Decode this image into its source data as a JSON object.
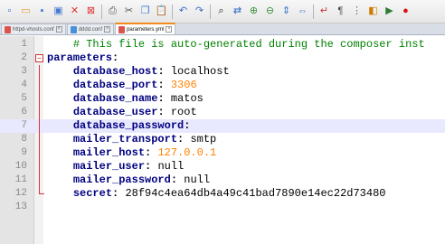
{
  "toolbar": {
    "icons": [
      "new-file-icon",
      "open-file-icon",
      "save-icon",
      "save-all-icon",
      "close-icon",
      "close-all-icon",
      "print-icon",
      "cut-icon",
      "copy-icon",
      "paste-icon",
      "undo-icon",
      "redo-icon",
      "find-icon",
      "replace-icon",
      "zoom-in-icon",
      "zoom-out-icon",
      "sync-v-icon",
      "sync-h-icon",
      "wrap-icon",
      "show-all-icon",
      "indent-guide-icon",
      "lang-icon",
      "macro-icon",
      "record-icon"
    ]
  },
  "tabs": [
    {
      "label": "httpd-vhosts.conf",
      "active": false,
      "color": "#d9534f"
    },
    {
      "label": "dddd.conf",
      "active": false,
      "color": "#4a90d9"
    },
    {
      "label": "parameters.yml",
      "active": true,
      "color": "#d9534f"
    }
  ],
  "lines": [
    {
      "num": "1",
      "indent": "    ",
      "comment": "# This file is auto-generated during the composer inst"
    },
    {
      "num": "2",
      "indent": "",
      "key": "parameters",
      "sep": ":",
      "root": true
    },
    {
      "num": "3",
      "indent": "    ",
      "key": "database_host",
      "sep": ": ",
      "value": "localhost",
      "vtype": "str"
    },
    {
      "num": "4",
      "indent": "    ",
      "key": "database_port",
      "sep": ": ",
      "value": "3306",
      "vtype": "num"
    },
    {
      "num": "5",
      "indent": "    ",
      "key": "database_name",
      "sep": ": ",
      "value": "matos",
      "vtype": "str"
    },
    {
      "num": "6",
      "indent": "    ",
      "key": "database_user",
      "sep": ": ",
      "value": "root",
      "vtype": "str"
    },
    {
      "num": "7",
      "indent": "    ",
      "key": "database_password",
      "sep": ":",
      "value": "",
      "vtype": "str",
      "highlight": true
    },
    {
      "num": "8",
      "indent": "    ",
      "key": "mailer_transport",
      "sep": ": ",
      "value": "smtp",
      "vtype": "str"
    },
    {
      "num": "9",
      "indent": "    ",
      "key": "mailer_host",
      "sep": ": ",
      "value": "127.0.0.1",
      "vtype": "num"
    },
    {
      "num": "10",
      "indent": "    ",
      "key": "mailer_user",
      "sep": ": ",
      "value": "null",
      "vtype": "str"
    },
    {
      "num": "11",
      "indent": "    ",
      "key": "mailer_password",
      "sep": ": ",
      "value": "null",
      "vtype": "str"
    },
    {
      "num": "12",
      "indent": "    ",
      "key": "secret",
      "sep": ": ",
      "value": "28f94c4ea64db4a49c41bad7890e14ec22d73480",
      "vtype": "str",
      "last": true
    },
    {
      "num": "13",
      "indent": ""
    }
  ],
  "colors": {
    "keyword": "#000080",
    "number": "#ff8000",
    "comment": "#008000",
    "highlight": "#e8e8ff"
  }
}
